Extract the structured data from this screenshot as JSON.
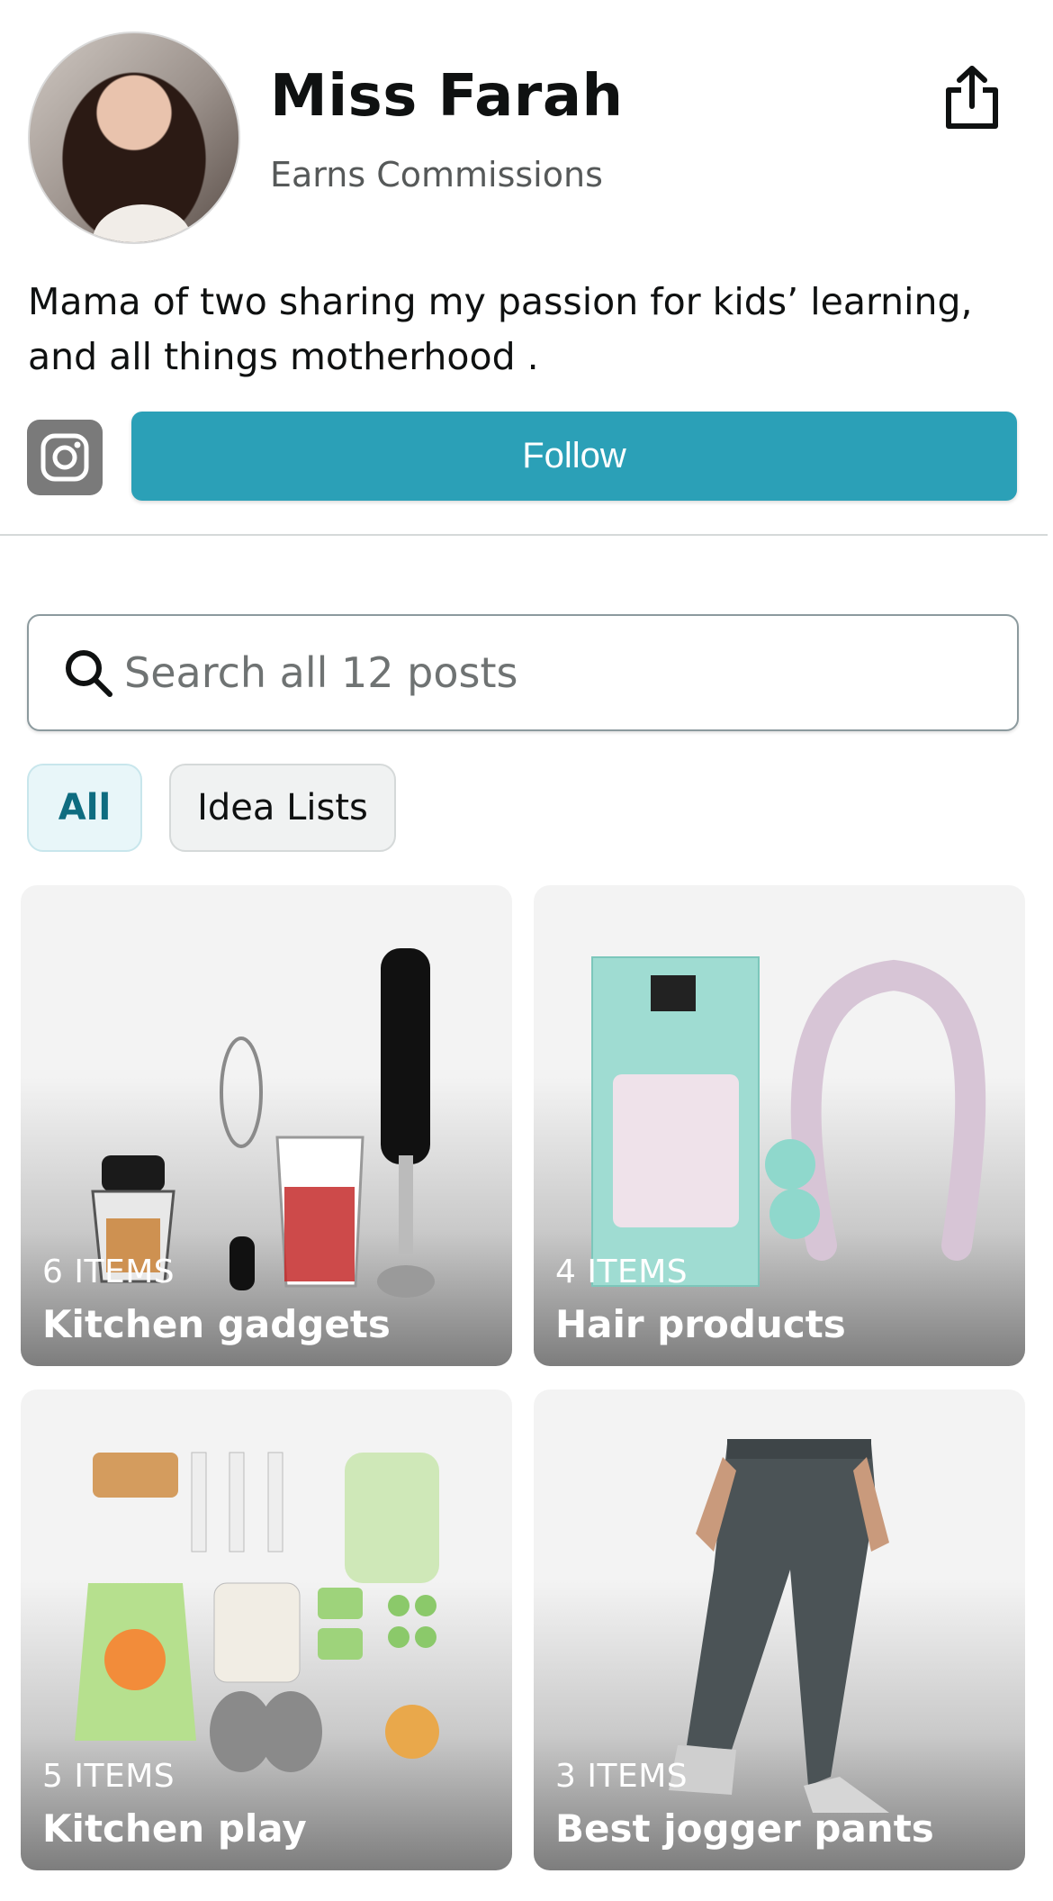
{
  "profile": {
    "name": "Miss Farah",
    "subtitle": "Earns Commissions",
    "bio": "Mama of two sharing my passion for kids’ learning, and all things motherhood .",
    "follow_label": "Follow"
  },
  "search": {
    "placeholder": "Search all 12 posts"
  },
  "filters": {
    "all_label": "All",
    "idea_lists_label": "Idea Lists"
  },
  "cards": [
    {
      "count": "6 ITEMS",
      "title": "Kitchen gadgets"
    },
    {
      "count": "4 ITEMS",
      "title": "Hair products"
    },
    {
      "count": "5 ITEMS",
      "title": "Kitchen play"
    },
    {
      "count": "3 ITEMS",
      "title": "Best jogger pants"
    }
  ],
  "colors": {
    "accent": "#2ba0b7",
    "chip_active_text": "#0e6c80",
    "secondary_text": "#565959"
  }
}
